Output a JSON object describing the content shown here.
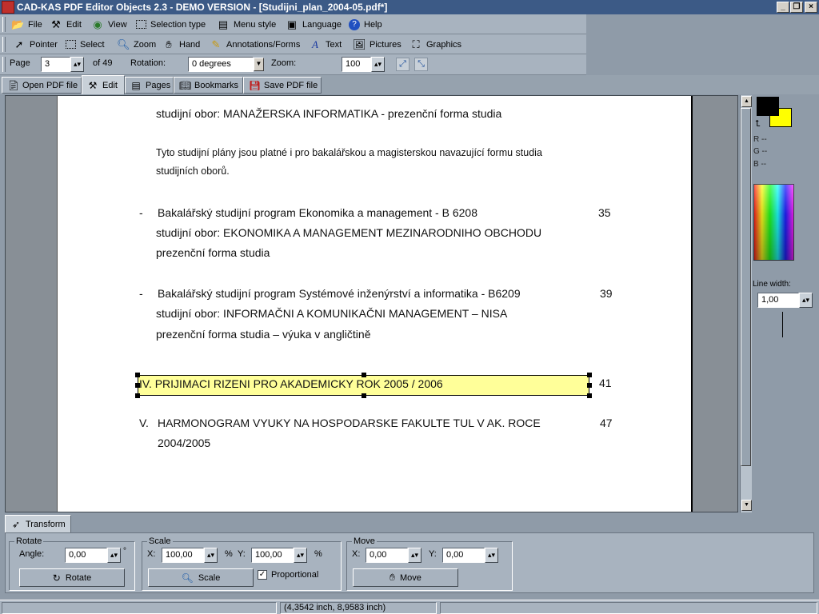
{
  "window": {
    "title": "CAD-KAS PDF Editor Objects 2.3 - DEMO VERSION - [Studijni_plan_2004-05.pdf*]",
    "minimize_glyph": "_",
    "restore_glyph": "❐",
    "close_glyph": "×"
  },
  "menu": {
    "file": "File",
    "edit": "Edit",
    "view": "View",
    "selection_type": "Selection type",
    "menu_style": "Menu style",
    "language": "Language",
    "help": "Help"
  },
  "tools": {
    "pointer": "Pointer",
    "select": "Select",
    "zoom": "Zoom",
    "hand": "Hand",
    "annotations": "Annotations/Forms",
    "text": "Text",
    "pictures": "Pictures",
    "graphics": "Graphics"
  },
  "nav": {
    "page_label": "Page",
    "page_value": "3",
    "of_pages": "of 49",
    "rotation_label": "Rotation:",
    "rotation_value": "0 degrees",
    "zoom_label": "Zoom:",
    "zoom_value": "100"
  },
  "tabs": {
    "open": "Open PDF file",
    "edit": "Edit",
    "pages": "Pages",
    "bookmarks": "Bookmarks",
    "save": "Save PDF file"
  },
  "document": {
    "l1": "studijní obor: MANAŽERSKA INFORMATIKA - prezenční forma studia",
    "l2": "Tyto studijní plány jsou platné i pro bakalářskou a magisterskou navazující formu studia",
    "l3": "studijních oborů.",
    "b1_dash": "-",
    "b1_a": "Bakalářský studijní program Ekonomika a management - B 6208",
    "b1_page": "35",
    "b1_b": "studijní obor: EKONOMIKA A MANAGEMENT MEZINARODNIHO OBCHODU",
    "b1_c": "prezenční forma studia",
    "b2_dash": "-",
    "b2_a": "Bakalářský studijní program   Systémové inženýrství a informatika - B6209",
    "b2_page": "39",
    "b2_b": "studijní obor: INFORMAČNI A KOMUNIKAČNI MANAGEMENT – NISA",
    "b2_c": "prezenční forma studia – výuka v angličtině",
    "s4": "IV. PRIJIMACI RIZENI PRO AKADEMICKY ROK 2005 / 2006",
    "s4_page": "41",
    "s5_num": "V.",
    "s5_a": "HARMONOGRAM VYUKY NA HOSPODARSKE FAKULTE TUL V AK. ROCE",
    "s5_b": "2004/2005",
    "s5_page": "47"
  },
  "color_panel": {
    "r": "R --",
    "g": "G --",
    "b": "B --",
    "line_width_label": "Line width:",
    "line_width_value": "1,00",
    "primary_color": "#000000",
    "secondary_color": "#ffff00"
  },
  "transform": {
    "tab": "Transform",
    "rotate_title": "Rotate",
    "angle_label": "Angle:",
    "angle_value": "0,00",
    "angle_unit": "°",
    "rotate_btn": "Rotate",
    "scale_title": "Scale",
    "scale_x_label": "X:",
    "scale_x_value": "100,00",
    "scale_x_unit": "%",
    "scale_y_label": "Y:",
    "scale_y_value": "100,00",
    "scale_y_unit": "%",
    "scale_btn": "Scale",
    "proportional": "Proportional",
    "move_title": "Move",
    "move_x_label": "X:",
    "move_x_value": "0,00",
    "move_y_label": "Y:",
    "move_y_value": "0,00",
    "move_btn": "Move"
  },
  "status": {
    "coords": "(4,3542 inch, 8,9583 inch)"
  },
  "selection_color": "#ffff99"
}
